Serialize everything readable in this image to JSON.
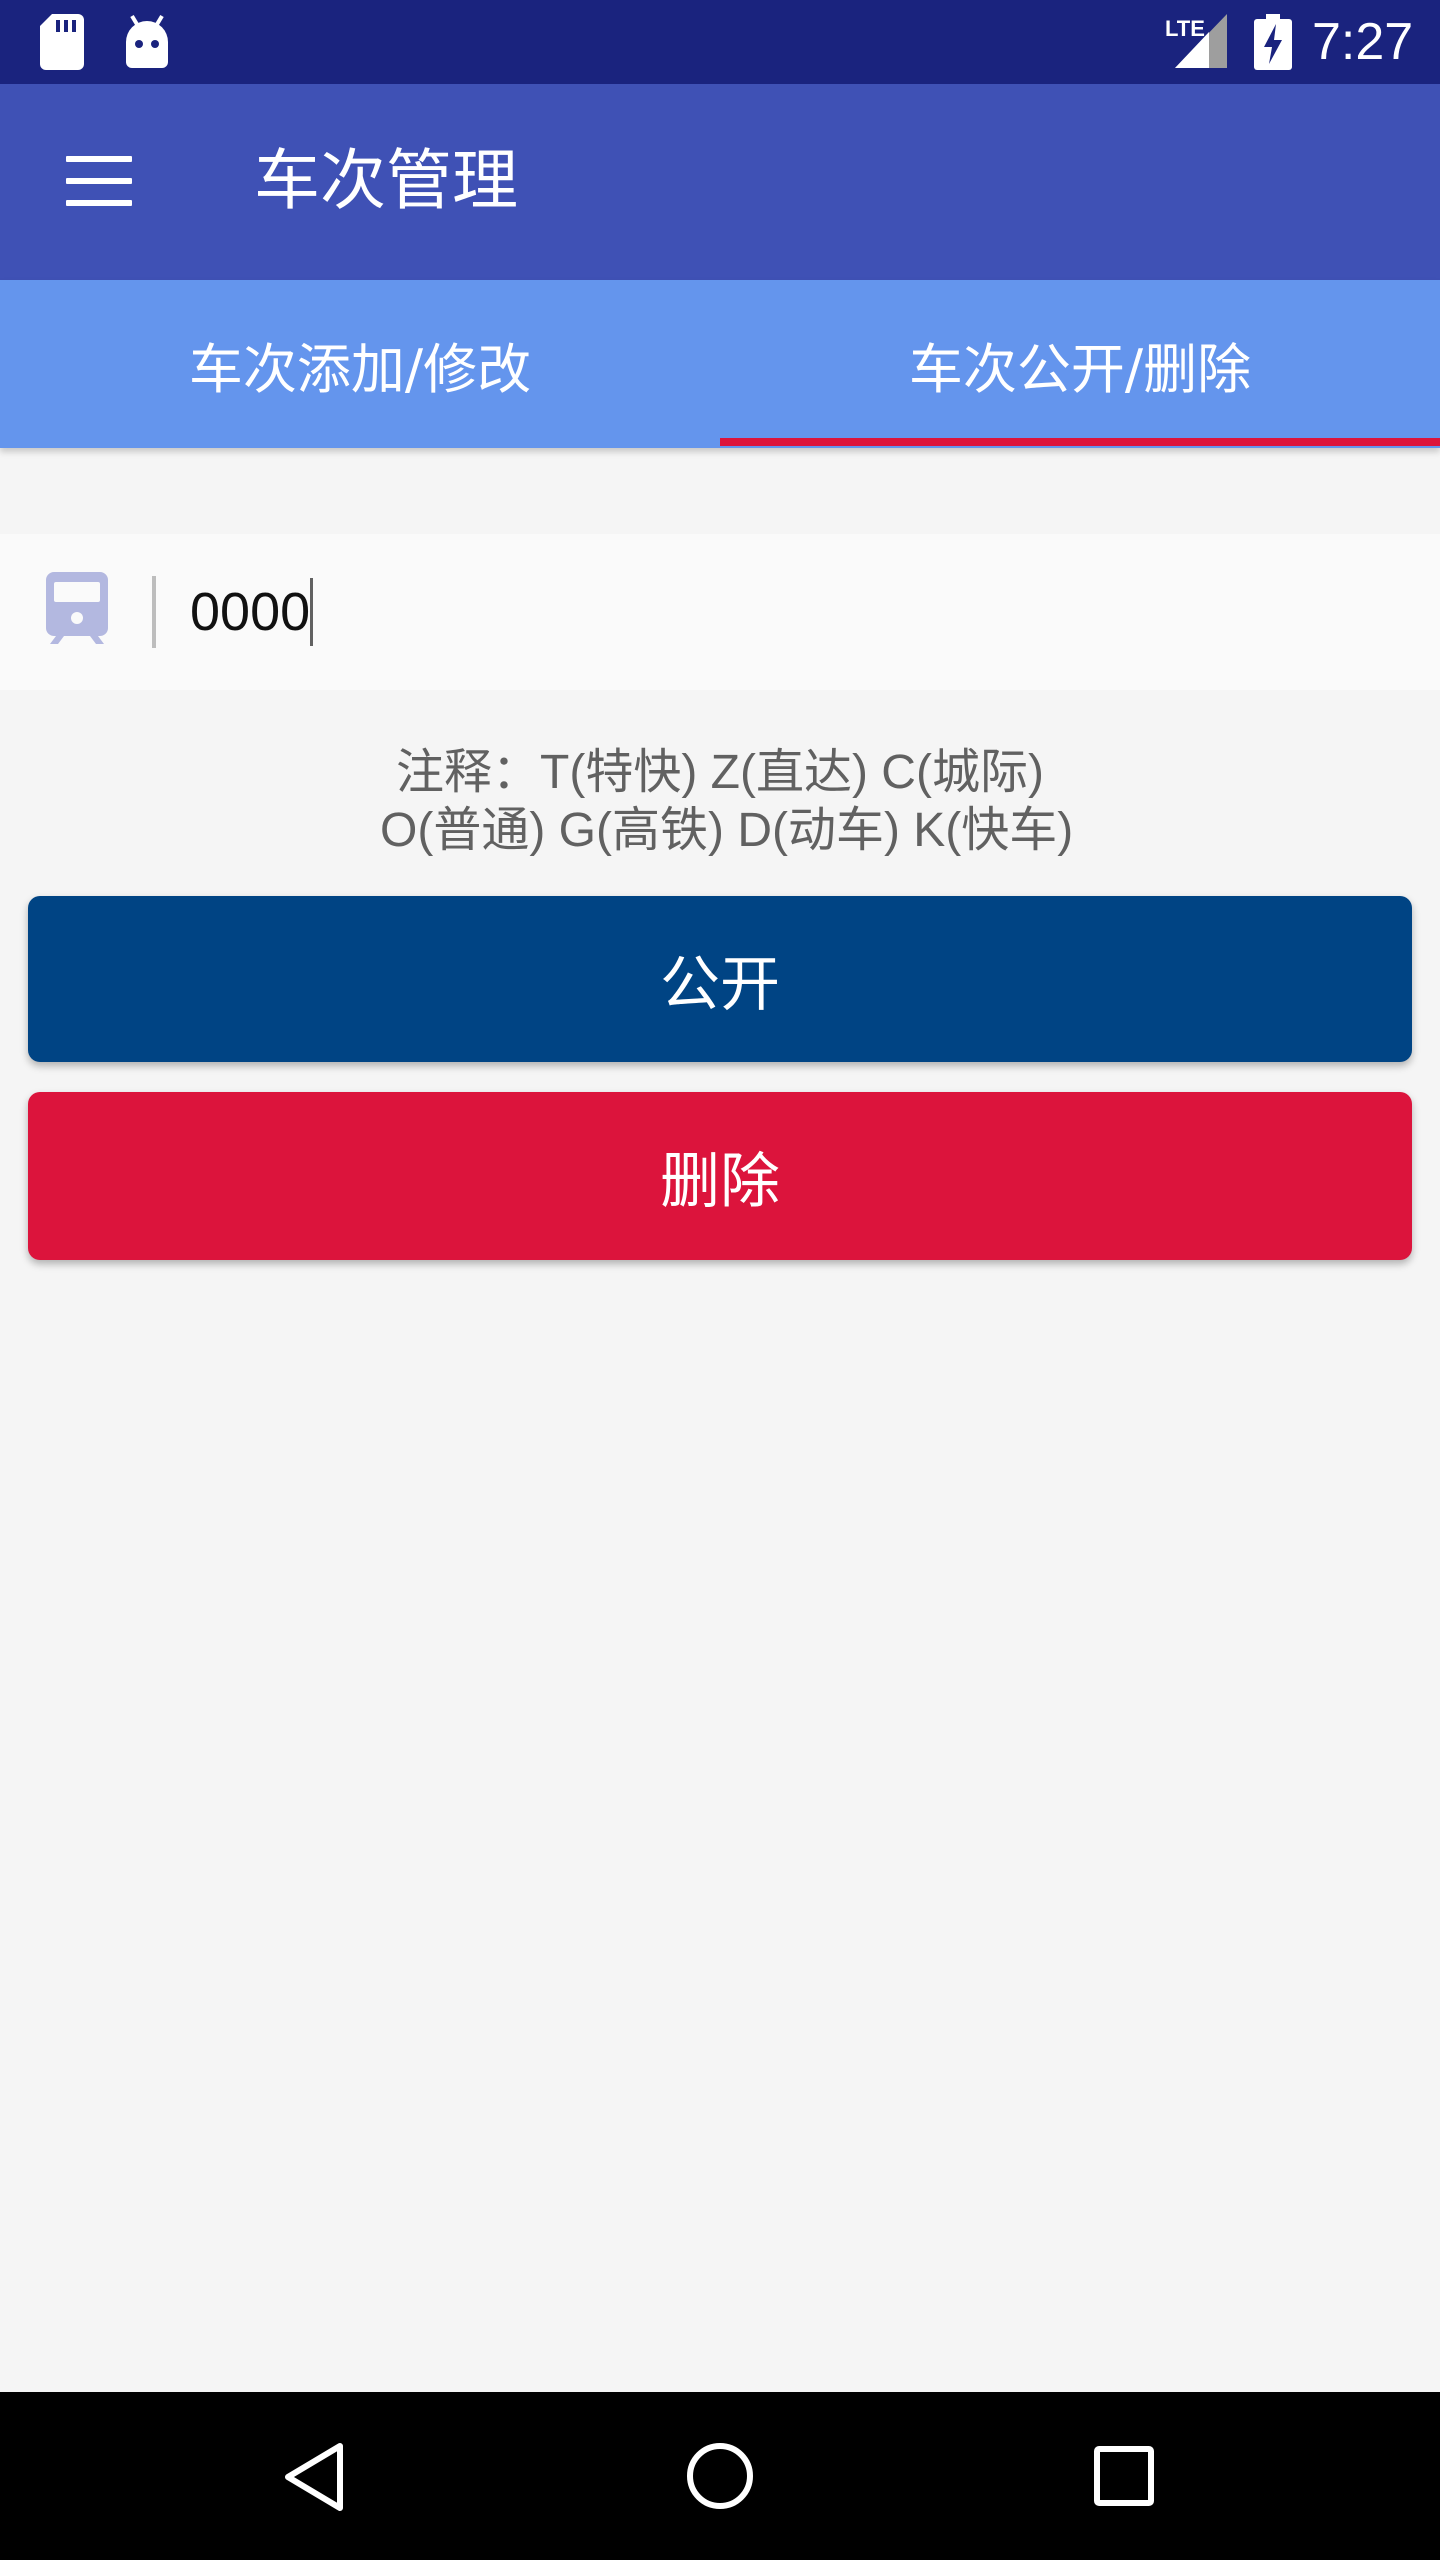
{
  "status_bar": {
    "network_label": "LTE",
    "time": "7:27"
  },
  "app_bar": {
    "title": "车次管理",
    "menu_icon": "hamburger-menu-icon"
  },
  "tabs": [
    {
      "label": "车次添加/修改",
      "selected": false
    },
    {
      "label": "车次公开/删除",
      "selected": true
    }
  ],
  "train_input": {
    "icon": "train-icon",
    "value": "0000"
  },
  "note": {
    "line1": "注释：T(特快) Z(直达)  C(城际)",
    "line2": " O(普通) G(高铁) D(动车) K(快车)"
  },
  "buttons": {
    "publish_label": "公开",
    "delete_label": "删除"
  },
  "colors": {
    "status_bar": "#1a237e",
    "app_bar": "#3f51b5",
    "tab_bar": "#6495ed",
    "tab_indicator": "#dc143c",
    "publish_button": "#004484",
    "delete_button": "#dc143c"
  }
}
